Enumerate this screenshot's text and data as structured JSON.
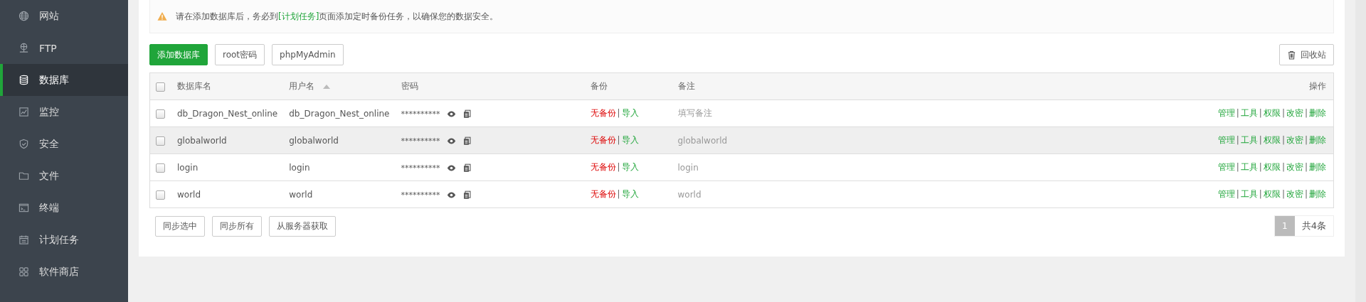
{
  "sidebar": {
    "items": [
      {
        "label": "网站",
        "selected": false
      },
      {
        "label": "FTP",
        "selected": false
      },
      {
        "label": "数据库",
        "selected": true
      },
      {
        "label": "监控",
        "selected": false
      },
      {
        "label": "安全",
        "selected": false
      },
      {
        "label": "文件",
        "selected": false
      },
      {
        "label": "终端",
        "selected": false
      },
      {
        "label": "计划任务",
        "selected": false
      },
      {
        "label": "软件商店",
        "selected": false
      }
    ]
  },
  "alert": {
    "text": "请在添加数据库后，务必到",
    "link": "[计划任务]",
    "text_after": "页面添加定时备份任务，以确保您的数据安全。"
  },
  "toolbar": {
    "primary_button": "添加数据库",
    "buttons": [
      "root密码",
      "phpMyAdmin"
    ],
    "recycle_button": "回收站"
  },
  "table": {
    "select_all_checked": false,
    "columns": [
      {
        "label": "数据库名",
        "sorted": false
      },
      {
        "label": "用户名",
        "sorted": true
      },
      {
        "label": "密码",
        "sorted": false
      },
      {
        "label": "备份",
        "sorted": false
      },
      {
        "label": "备注",
        "sorted": false
      },
      {
        "label": "操作",
        "sorted": false
      }
    ],
    "rows": [
      {
        "checked": false,
        "highlighted": false,
        "name": "db_Dragon_Nest_online",
        "user": "db_Dragon_Nest_online",
        "password": "**********",
        "backup": "无备份",
        "separator": "|",
        "import": "导入",
        "note": "填写备注",
        "actions": [
          {
            "kind": "link",
            "text": "管理"
          },
          {
            "kind": "separator",
            "text": "|"
          },
          {
            "kind": "link",
            "text": "工具"
          },
          {
            "kind": "separator",
            "text": "|"
          },
          {
            "kind": "link",
            "text": "权限"
          },
          {
            "kind": "separator",
            "text": "|"
          },
          {
            "kind": "link",
            "text": "改密"
          },
          {
            "kind": "separator",
            "text": "|"
          },
          {
            "kind": "link",
            "text": "删除"
          }
        ]
      },
      {
        "checked": false,
        "highlighted": true,
        "name": "globalworld",
        "user": "globalworld",
        "password": "**********",
        "backup": "无备份",
        "separator": "|",
        "import": "导入",
        "note": "globalworld",
        "actions": [
          {
            "kind": "link",
            "text": "管理"
          },
          {
            "kind": "separator",
            "text": "|"
          },
          {
            "kind": "link",
            "text": "工具"
          },
          {
            "kind": "separator",
            "text": "|"
          },
          {
            "kind": "link",
            "text": "权限"
          },
          {
            "kind": "separator",
            "text": "|"
          },
          {
            "kind": "link",
            "text": "改密"
          },
          {
            "kind": "separator",
            "text": "|"
          },
          {
            "kind": "link",
            "text": "删除"
          }
        ]
      },
      {
        "checked": false,
        "highlighted": false,
        "name": "login",
        "user": "login",
        "password": "**********",
        "backup": "无备份",
        "separator": "|",
        "import": "导入",
        "note": "login",
        "actions": [
          {
            "kind": "link",
            "text": "管理"
          },
          {
            "kind": "separator",
            "text": "|"
          },
          {
            "kind": "link",
            "text": "工具"
          },
          {
            "kind": "separator",
            "text": "|"
          },
          {
            "kind": "link",
            "text": "权限"
          },
          {
            "kind": "separator",
            "text": "|"
          },
          {
            "kind": "link",
            "text": "改密"
          },
          {
            "kind": "separator",
            "text": "|"
          },
          {
            "kind": "link",
            "text": "删除"
          }
        ]
      },
      {
        "checked": false,
        "highlighted": false,
        "name": "world",
        "user": "world",
        "password": "**********",
        "backup": "无备份",
        "separator": "|",
        "import": "导入",
        "note": "world",
        "actions": [
          {
            "kind": "link",
            "text": "管理"
          },
          {
            "kind": "separator",
            "text": "|"
          },
          {
            "kind": "link",
            "text": "工具"
          },
          {
            "kind": "separator",
            "text": "|"
          },
          {
            "kind": "link",
            "text": "权限"
          },
          {
            "kind": "separator",
            "text": "|"
          },
          {
            "kind": "link",
            "text": "改密"
          },
          {
            "kind": "separator",
            "text": "|"
          },
          {
            "kind": "link",
            "text": "删除"
          }
        ]
      }
    ]
  },
  "footer_buttons": [
    "同步选中",
    "同步所有",
    "从服务器获取"
  ],
  "pagination": {
    "current": "1",
    "total": "共4条"
  }
}
